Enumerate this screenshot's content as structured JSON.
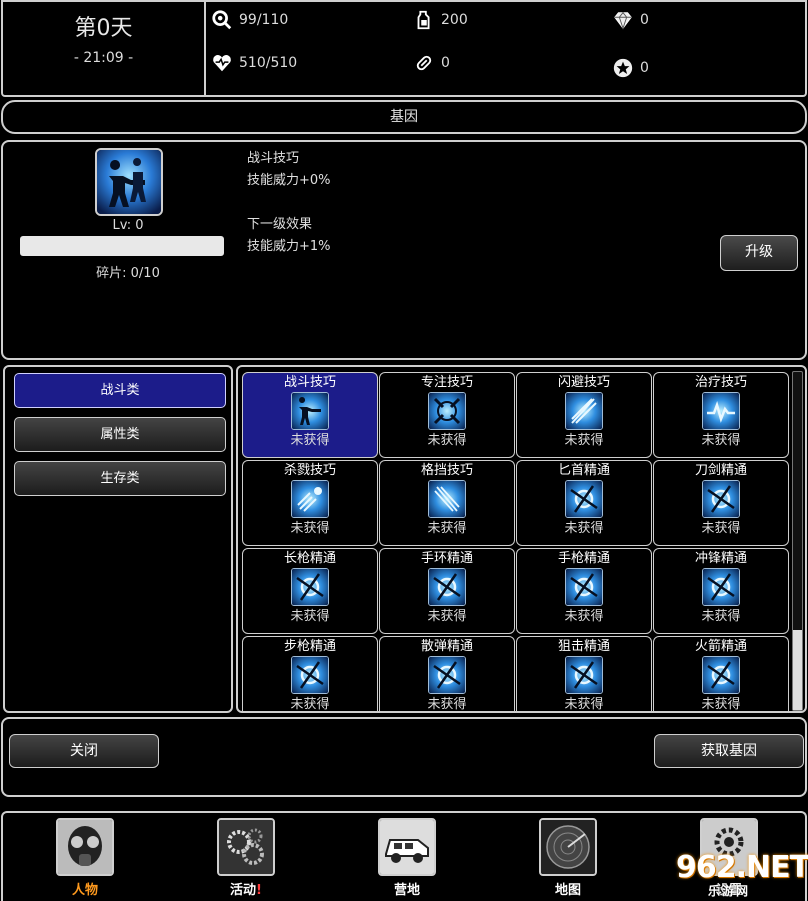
{
  "topbar": {
    "day": "第0天",
    "clock": "- 21:09 -",
    "stats": {
      "food": "99/110",
      "water": "200",
      "diamond": "0",
      "health": "510/510",
      "medicine": "0",
      "star": "0"
    }
  },
  "header": {
    "title": "基因"
  },
  "detail": {
    "lv": "Lv: 0",
    "progress": 0,
    "shards": "碎片: 0/10",
    "name": "战斗技巧",
    "effect": "技能威力+0%",
    "next_title": "下一级效果",
    "next_effect": "技能威力+1%",
    "upgrade": "升级"
  },
  "categories": [
    {
      "label": "战斗类",
      "active": true
    },
    {
      "label": "属性类",
      "active": false
    },
    {
      "label": "生存类",
      "active": false
    }
  ],
  "genes": [
    {
      "name": "战斗技巧",
      "status": "未获得",
      "icon": "soldier-icon",
      "selected": true
    },
    {
      "name": "专注技巧",
      "status": "未获得",
      "icon": "focus-icon"
    },
    {
      "name": "闪避技巧",
      "status": "未获得",
      "icon": "dodge-icon"
    },
    {
      "name": "治疗技巧",
      "status": "未获得",
      "icon": "heal-icon"
    },
    {
      "name": "杀戮技巧",
      "status": "未获得",
      "icon": "kill-icon"
    },
    {
      "name": "格挡技巧",
      "status": "未获得",
      "icon": "block-icon"
    },
    {
      "name": "匕首精通",
      "status": "未获得",
      "icon": "mastery-icon"
    },
    {
      "name": "刀剑精通",
      "status": "未获得",
      "icon": "mastery-icon"
    },
    {
      "name": "长枪精通",
      "status": "未获得",
      "icon": "mastery-icon"
    },
    {
      "name": "手环精通",
      "status": "未获得",
      "icon": "mastery-icon"
    },
    {
      "name": "手枪精通",
      "status": "未获得",
      "icon": "mastery-icon"
    },
    {
      "name": "冲锋精通",
      "status": "未获得",
      "icon": "mastery-icon"
    },
    {
      "name": "步枪精通",
      "status": "未获得",
      "icon": "mastery-icon"
    },
    {
      "name": "散弹精通",
      "status": "未获得",
      "icon": "mastery-icon"
    },
    {
      "name": "狙击精通",
      "status": "未获得",
      "icon": "mastery-icon"
    },
    {
      "name": "火箭精通",
      "status": "未获得",
      "icon": "mastery-icon"
    }
  ],
  "actions": {
    "close": "关闭",
    "obtain": "获取基因"
  },
  "nav": [
    {
      "label": "人物",
      "icon": "gas-mask-icon",
      "active": true
    },
    {
      "label": "活动",
      "icon": "gear-cluster-icon",
      "badge": "!"
    },
    {
      "label": "营地",
      "icon": "vehicle-icon"
    },
    {
      "label": "地图",
      "icon": "radar-icon"
    },
    {
      "label": "设置",
      "icon": "settings-icon"
    }
  ],
  "watermark": {
    "text": "962.NET",
    "sub": "乐游网"
  },
  "colors": {
    "selected": "#1c1c8a",
    "active_nav": "#ff9a1e",
    "badge": "#ff3b3b"
  }
}
